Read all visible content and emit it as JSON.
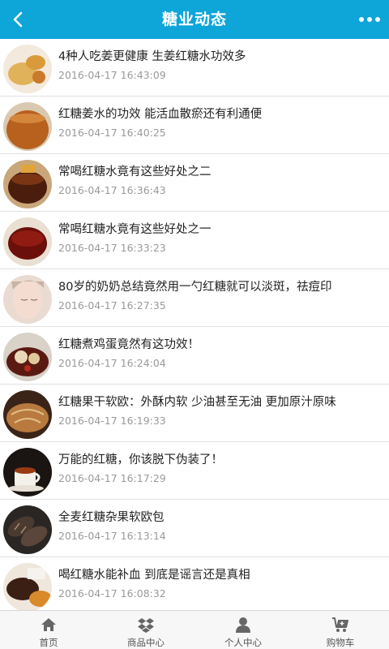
{
  "header": {
    "title": "糖业动态",
    "back_icon": "chevron-left-icon",
    "more_icon": "more-dots-icon",
    "color": "#0ea5d8"
  },
  "articles": [
    {
      "title": "4种人吃姜更健康 生姜红糖水功效多",
      "time": "2016-04-17 16:43:09",
      "thumb": "ginger"
    },
    {
      "title": "红糖姜水的功效 能活血散瘀还有利通便",
      "time": "2016-04-17 16:40:25",
      "thumb": "tea-glass"
    },
    {
      "title": "常喝红糖水竟有这些好处之二",
      "time": "2016-04-17 16:36:43",
      "thumb": "dark-tea"
    },
    {
      "title": "常喝红糖水竟有这些好处之一",
      "time": "2016-04-17 16:33:23",
      "thumb": "red-tea"
    },
    {
      "title": "80岁的奶奶总结竟然用一勺红糖就可以淡斑，祛痘印",
      "time": "2016-04-17 16:27:35",
      "thumb": "face"
    },
    {
      "title": "红糖煮鸡蛋竟然有这功效！",
      "time": "2016-04-17 16:24:04",
      "thumb": "egg-soup"
    },
    {
      "title": "红糖果干软欧：外酥内软 少油甚至无油 更加原汁原味",
      "time": "2016-04-17 16:19:33",
      "thumb": "bread"
    },
    {
      "title": "万能的红糖，你该脱下伪装了！",
      "time": "2016-04-17 16:17:29",
      "thumb": "tea-cup"
    },
    {
      "title": "全麦红糖杂果软欧包",
      "time": "2016-04-17 16:13:14",
      "thumb": "dark-bread"
    },
    {
      "title": "喝红糖水能补血 到底是谣言还是真相",
      "time": "2016-04-17 16:08:32",
      "thumb": "sugar-bowl"
    }
  ],
  "tabbar": {
    "tabs": [
      {
        "label": "首页",
        "icon": "home-icon"
      },
      {
        "label": "商品中心",
        "icon": "dropbox-icon"
      },
      {
        "label": "个人中心",
        "icon": "user-icon"
      },
      {
        "label": "购物车",
        "icon": "cart-icon"
      }
    ]
  }
}
